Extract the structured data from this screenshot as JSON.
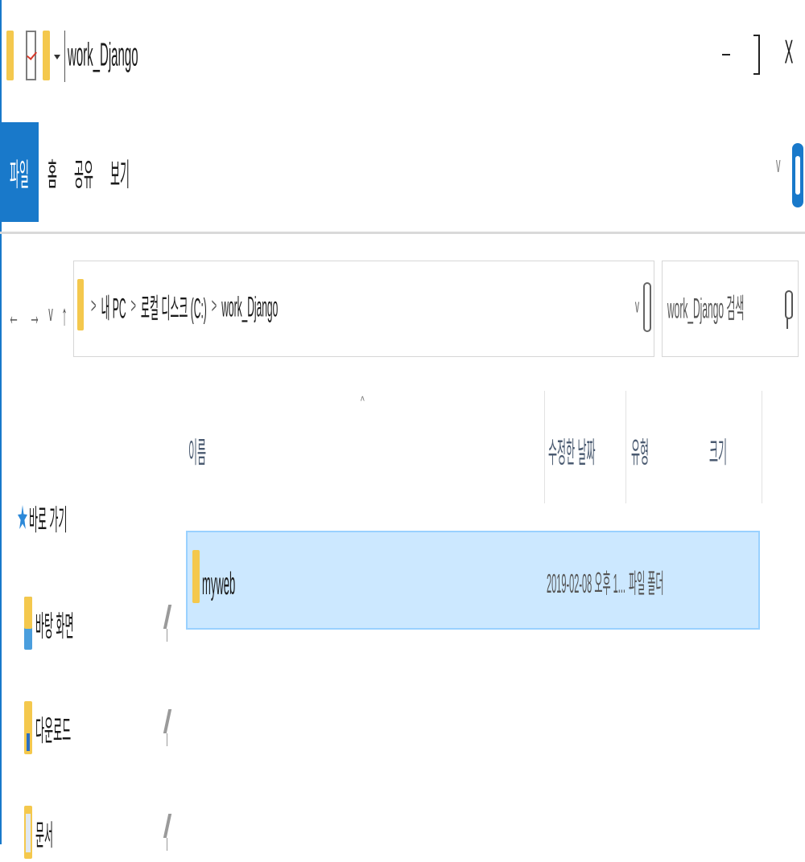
{
  "window": {
    "title": "work_Django",
    "minimize_label": "-",
    "close_label": "X"
  },
  "ribbon": {
    "tabs": [
      "파일",
      "홈",
      "공유",
      "보기"
    ],
    "expand_label": "v"
  },
  "nav": {
    "back_label": "←",
    "forward_label": "→",
    "recent_label": "v",
    "up_label": "↑"
  },
  "address": {
    "crumbs": [
      "내 PC",
      "로컬 디스크 (C:)",
      "work_Django"
    ],
    "separator": ">",
    "dropdown_label": "v"
  },
  "search": {
    "placeholder": "work_Django 검색"
  },
  "columns": {
    "sort_indicator": "^",
    "name": "이름",
    "date": "수정한 날짜",
    "type": "유형",
    "size": "크기"
  },
  "files": [
    {
      "name": "myweb",
      "date": "2019-02-08 오후 1...",
      "type": "파일 폴더",
      "size": ""
    }
  ],
  "sidebar": {
    "quick_access": "바로 가기",
    "items": [
      {
        "label": "바탕 화면",
        "icon": "desktop-icon"
      },
      {
        "label": "다운로드",
        "icon": "downloads-icon"
      },
      {
        "label": "문서",
        "icon": "documents-icon"
      }
    ]
  },
  "colors": {
    "accent": "#1979ca",
    "selection_bg": "#cce8ff",
    "selection_border": "#99d1ff",
    "folder": "#f4c84d"
  }
}
